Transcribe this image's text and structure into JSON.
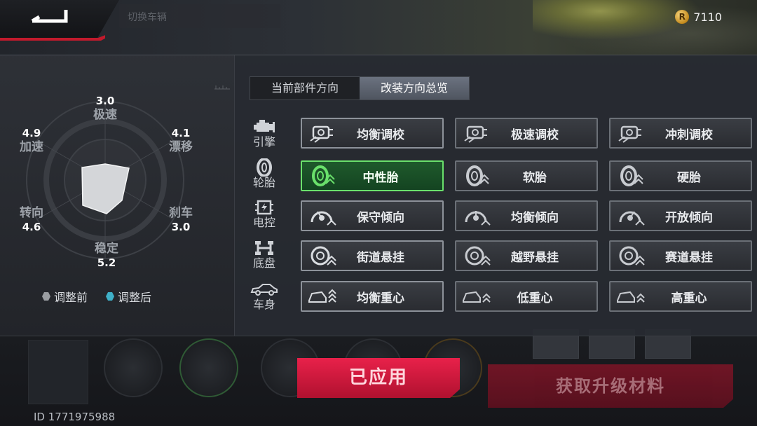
{
  "header": {
    "ghost_title": "切换车辆",
    "currency_icon": "r-coin-icon",
    "currency_amount": "7110"
  },
  "stats": {
    "top": {
      "label": "极速",
      "value": "3.0"
    },
    "top_left": {
      "label": "加速",
      "value": "4.9"
    },
    "top_right": {
      "label": "漂移",
      "value": "4.1"
    },
    "bottom_left": {
      "label": "转向",
      "value": "4.6"
    },
    "bottom_right": {
      "label": "刹车",
      "value": "3.0"
    },
    "bottom": {
      "label": "稳定",
      "value": "5.2"
    }
  },
  "legend": {
    "before": "调整前",
    "after": "调整后",
    "before_color": "#9a9da2",
    "after_color": "#3fb0c8"
  },
  "tabs": [
    "当前部件方向",
    "改装方向总览"
  ],
  "categories": [
    {
      "label": "引擎",
      "icon": "engine-icon"
    },
    {
      "label": "轮胎",
      "icon": "tire-icon"
    },
    {
      "label": "电控",
      "icon": "chip-icon"
    },
    {
      "label": "底盘",
      "icon": "chassis-icon"
    },
    {
      "label": "车身",
      "icon": "car-body-icon"
    }
  ],
  "options": {
    "engine": [
      "均衡调校",
      "极速调校",
      "冲刺调校"
    ],
    "tire": [
      "中性胎",
      "软胎",
      "硬胎"
    ],
    "ecu": [
      "保守倾向",
      "均衡倾向",
      "开放倾向"
    ],
    "chassis": [
      "街道悬挂",
      "越野悬挂",
      "赛道悬挂"
    ],
    "body": [
      "均衡重心",
      "低重心",
      "高重心"
    ]
  },
  "selected_option": "中性胎",
  "buttons": {
    "apply": "已应用",
    "get_materials": "获取升级材料"
  },
  "footer": {
    "id_text": "ID 1771975988"
  },
  "colors": {
    "accent_red": "#c21a2c",
    "selected_green": "#6ae06b"
  }
}
